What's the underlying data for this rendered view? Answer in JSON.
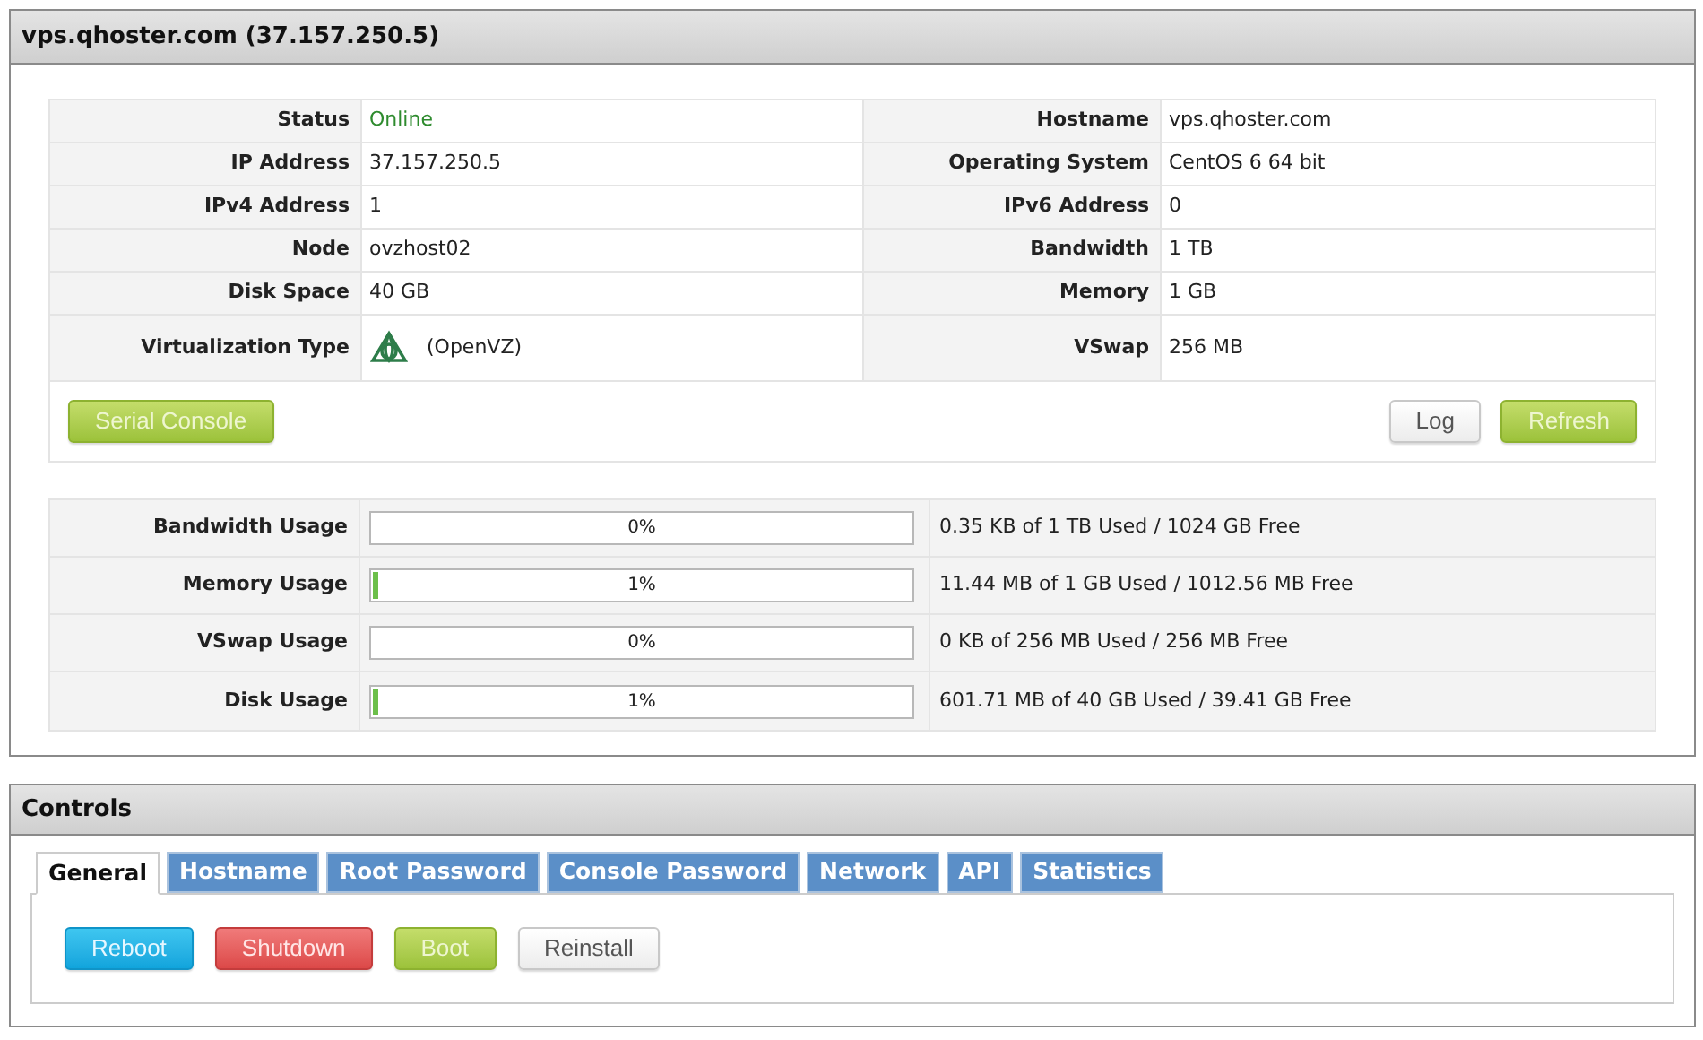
{
  "panel": {
    "title": "vps.qhoster.com (37.157.250.5)"
  },
  "info_rows": [
    [
      {
        "label": "Status",
        "value": "Online",
        "kind": "status"
      },
      {
        "label": "Hostname",
        "value": "vps.qhoster.com",
        "kind": "text"
      }
    ],
    [
      {
        "label": "IP Address",
        "value": "37.157.250.5",
        "kind": "text"
      },
      {
        "label": "Operating System",
        "value": "CentOS 6 64 bit",
        "kind": "text"
      }
    ],
    [
      {
        "label": "IPv4 Address",
        "value": "1",
        "kind": "text"
      },
      {
        "label": "IPv6 Address",
        "value": "0",
        "kind": "text"
      }
    ],
    [
      {
        "label": "Node",
        "value": "ovzhost02",
        "kind": "text"
      },
      {
        "label": "Bandwidth",
        "value": "1 TB",
        "kind": "text"
      }
    ],
    [
      {
        "label": "Disk Space",
        "value": "40 GB",
        "kind": "text"
      },
      {
        "label": "Memory",
        "value": "1 GB",
        "kind": "text"
      }
    ],
    [
      {
        "label": "Virtualization Type",
        "value": "(OpenVZ)",
        "kind": "logo"
      },
      {
        "label": "VSwap",
        "value": "256 MB",
        "kind": "text"
      }
    ]
  ],
  "info_buttons": {
    "left": [
      {
        "label": "Serial Console",
        "kind": "success"
      }
    ],
    "right": [
      {
        "label": "Log",
        "kind": "default"
      },
      {
        "label": "Refresh",
        "kind": "success"
      }
    ]
  },
  "usage": [
    {
      "label": "Bandwidth Usage",
      "level": 0,
      "percent": "0%",
      "detail": "0.35 KB of 1 TB Used / 1024 GB Free"
    },
    {
      "label": "Memory Usage",
      "level": 0.01,
      "percent": "1%",
      "detail": "11.44 MB of 1 GB Used / 1012.56 MB Free"
    },
    {
      "label": "VSwap Usage",
      "level": 0,
      "percent": "0%",
      "detail": "0 KB of 256 MB Used / 256 MB Free"
    },
    {
      "label": "Disk Usage",
      "level": 0.01,
      "percent": "1%",
      "detail": "601.71 MB of 40 GB Used / 39.41 GB Free"
    }
  ],
  "controls": {
    "title": "Controls",
    "tabs": [
      {
        "label": "General",
        "selected": true
      },
      {
        "label": "Hostname",
        "selected": false
      },
      {
        "label": "Root Password",
        "selected": false
      },
      {
        "label": "Console Password",
        "selected": false
      },
      {
        "label": "Network",
        "selected": false
      },
      {
        "label": "API",
        "selected": false
      },
      {
        "label": "Statistics",
        "selected": false
      }
    ],
    "buttons": [
      {
        "label": "Reboot",
        "kind": "info"
      },
      {
        "label": "Shutdown",
        "kind": "danger"
      },
      {
        "label": "Boot",
        "kind": "success"
      },
      {
        "label": "Reinstall",
        "kind": "default"
      }
    ]
  }
}
